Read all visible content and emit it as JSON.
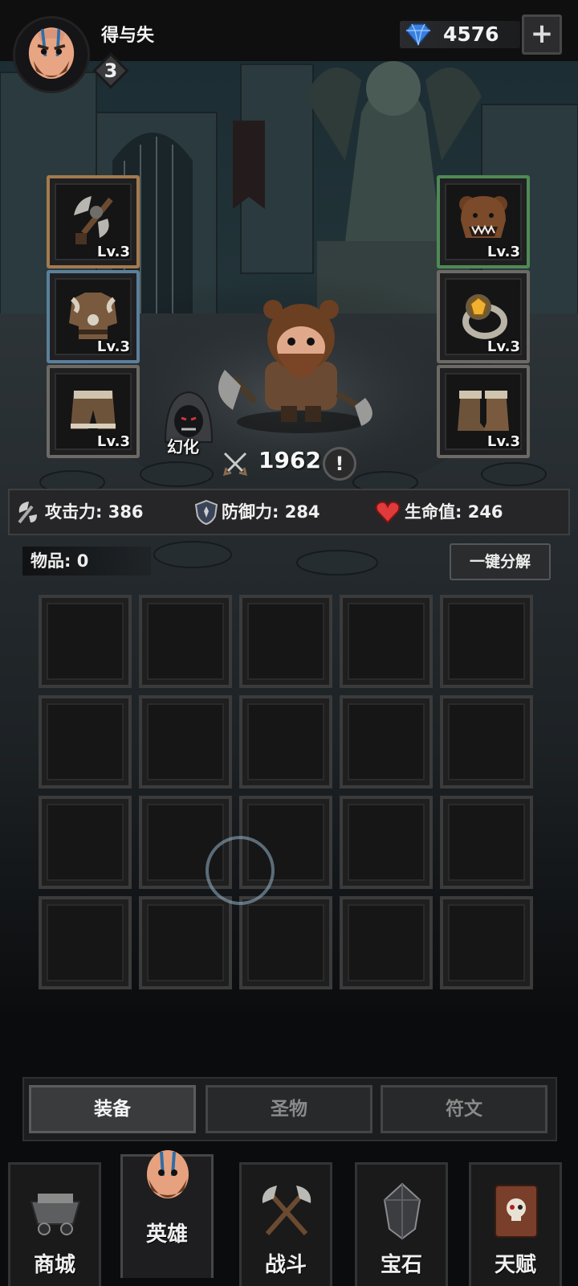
{
  "header": {
    "username": "得与失",
    "level": "3",
    "gems": "4576",
    "add_label": "+"
  },
  "equipment": {
    "left": [
      {
        "slot": "weapon",
        "icon": "battle-axe-icon",
        "level": "Lv.3",
        "border": "#a47a4e"
      },
      {
        "slot": "armor",
        "icon": "fur-armor-icon",
        "level": "Lv.3",
        "border": "#5b7f9b"
      },
      {
        "slot": "pants",
        "icon": "fur-pants-icon",
        "level": "Lv.3",
        "border": "#6d6a66"
      }
    ],
    "right": [
      {
        "slot": "helmet",
        "icon": "bear-helmet-icon",
        "level": "Lv.3",
        "border": "#4f8a55"
      },
      {
        "slot": "ring",
        "icon": "gem-ring-icon",
        "level": "Lv.3",
        "border": "#6d6a66"
      },
      {
        "slot": "boots",
        "icon": "fur-boots-icon",
        "level": "Lv.3",
        "border": "#6d6a66"
      }
    ]
  },
  "hero": {
    "illusion_label": "幻化",
    "power": "1962",
    "info_label": "!"
  },
  "stats": {
    "attack": "攻击力: 386",
    "defense": "防御力: 284",
    "hp": "生命值: 246"
  },
  "inventory": {
    "items_label": "物品: 0",
    "decompose_label": "一键分解",
    "rows": 4,
    "cols": 5
  },
  "tabs": [
    {
      "label": "装备",
      "active": true
    },
    {
      "label": "圣物",
      "active": false
    },
    {
      "label": "符文",
      "active": false
    }
  ],
  "nav": [
    {
      "label": "商城",
      "icon": "mine-cart-icon",
      "active": false
    },
    {
      "label": "英雄",
      "icon": "hero-portrait-icon",
      "active": true
    },
    {
      "label": "战斗",
      "icon": "crossed-axes-icon",
      "active": false
    },
    {
      "label": "宝石",
      "icon": "dark-gem-icon",
      "active": false
    },
    {
      "label": "天赋",
      "icon": "skull-book-icon",
      "active": false
    }
  ]
}
